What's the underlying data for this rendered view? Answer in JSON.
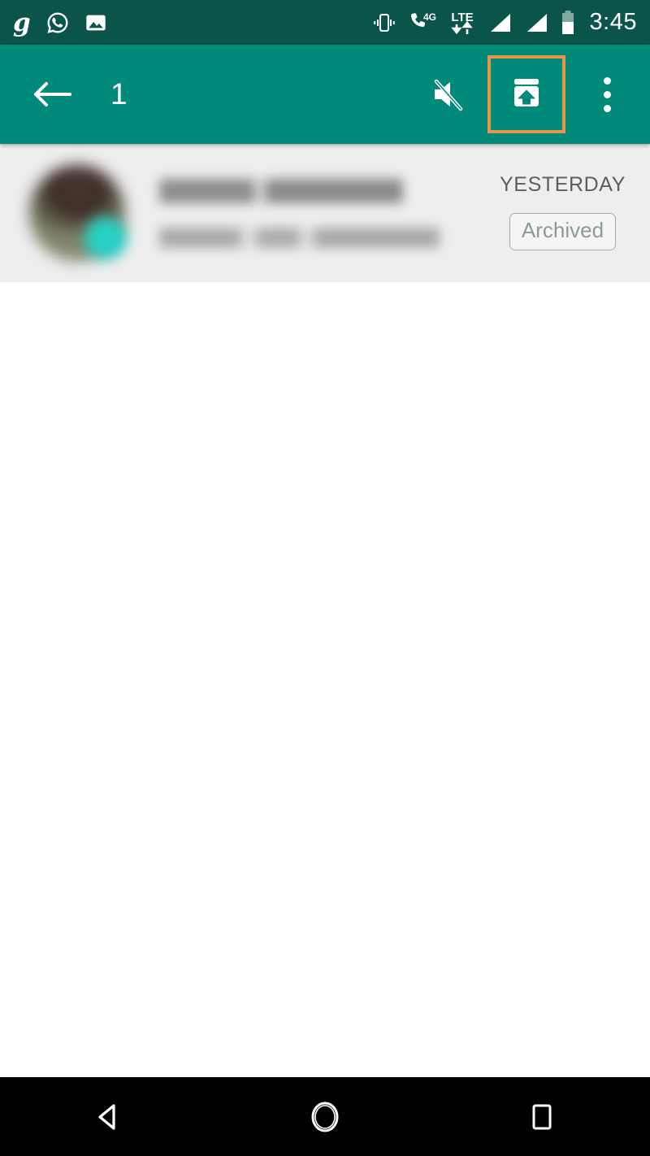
{
  "status_bar": {
    "background_color": "#0b544a",
    "notification_icons": [
      {
        "name": "grofers-g-icon",
        "glyph": "g"
      },
      {
        "name": "whatsapp-icon",
        "glyph": "whatsapp"
      },
      {
        "name": "photo-gallery-icon",
        "glyph": "image"
      }
    ],
    "system_icons": [
      {
        "name": "vibrate-icon",
        "label": "Vibrate"
      },
      {
        "name": "call-4g-icon",
        "label": "4G"
      },
      {
        "name": "lte-data-icon",
        "label": "LTE"
      },
      {
        "name": "signal-sim1-icon",
        "label": "Signal 1"
      },
      {
        "name": "signal-sim2-icon",
        "label": "Signal 2"
      },
      {
        "name": "battery-icon",
        "label": "Battery"
      }
    ],
    "clock": "3:45"
  },
  "toolbar": {
    "background_color": "#018a7a",
    "back_label": "Back",
    "selection_count": "1",
    "actions": [
      {
        "name": "mute-button",
        "label": "Mute"
      },
      {
        "name": "unarchive-button",
        "label": "Unarchive",
        "highlighted": true
      },
      {
        "name": "overflow-menu-button",
        "label": "More options"
      }
    ],
    "highlight_color": "#e8954d"
  },
  "chat_list": {
    "rows": [
      {
        "name_redacted": true,
        "message_redacted": true,
        "timestamp": "YESTERDAY",
        "badge": "Archived",
        "selected": true,
        "avatar_selected": true,
        "row_background": "#eeeeee"
      }
    ]
  },
  "nav_bar": {
    "background_color": "#000000",
    "buttons": [
      {
        "name": "nav-back-button",
        "label": "Back"
      },
      {
        "name": "nav-home-button",
        "label": "Home"
      },
      {
        "name": "nav-recents-button",
        "label": "Recents"
      }
    ]
  }
}
